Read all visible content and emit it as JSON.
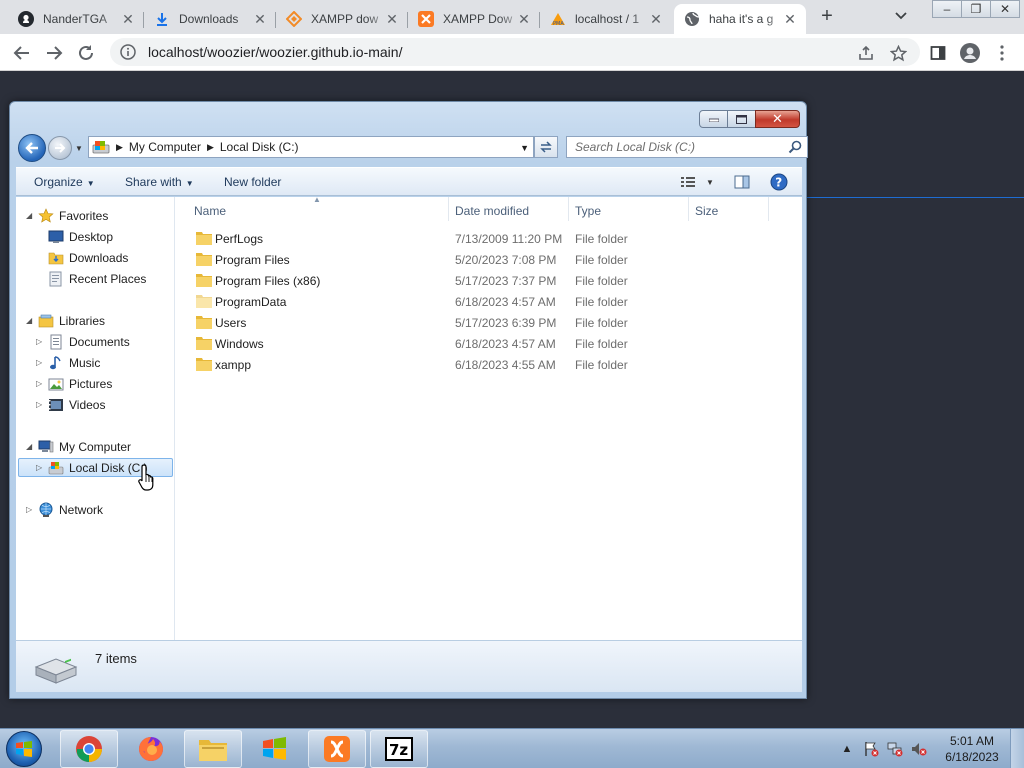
{
  "browser": {
    "tabs": [
      {
        "title": "NanderTGA",
        "icon": "github-icon"
      },
      {
        "title": "Downloads",
        "icon": "download-icon"
      },
      {
        "title": "XAMPP dow",
        "icon": "xampp-diamond-icon"
      },
      {
        "title": "XAMPP Dow",
        "icon": "xampp-icon"
      },
      {
        "title": "localhost / 1",
        "icon": "phpmyadmin-icon"
      },
      {
        "title": "haha it's a g",
        "icon": "globe-icon"
      }
    ],
    "active_tab": 5,
    "url": "localhost/woozier/woozier.github.io-main/"
  },
  "explorer": {
    "breadcrumb": [
      "My Computer",
      "Local Disk (C:)"
    ],
    "search_placeholder": "Search Local Disk (C:)",
    "commands": {
      "organize": "Organize",
      "share_with": "Share with",
      "new_folder": "New folder"
    },
    "nav": {
      "favorites": "Favorites",
      "desktop": "Desktop",
      "downloads": "Downloads",
      "recent_places": "Recent Places",
      "libraries": "Libraries",
      "documents": "Documents",
      "music": "Music",
      "pictures": "Pictures",
      "videos": "Videos",
      "my_computer": "My Computer",
      "local_disk": "Local Disk (C:)",
      "network": "Network"
    },
    "columns": {
      "name": "Name",
      "date_modified": "Date modified",
      "type": "Type",
      "size": "Size"
    },
    "files": [
      {
        "name": "PerfLogs",
        "date": "7/13/2009 11:20 PM",
        "type": "File folder"
      },
      {
        "name": "Program Files",
        "date": "5/20/2023 7:08 PM",
        "type": "File folder"
      },
      {
        "name": "Program Files (x86)",
        "date": "5/17/2023 7:37 PM",
        "type": "File folder"
      },
      {
        "name": "ProgramData",
        "date": "6/18/2023 4:57 AM",
        "type": "File folder"
      },
      {
        "name": "Users",
        "date": "5/17/2023 6:39 PM",
        "type": "File folder"
      },
      {
        "name": "Windows",
        "date": "6/18/2023 4:57 AM",
        "type": "File folder"
      },
      {
        "name": "xampp",
        "date": "6/18/2023 4:55 AM",
        "type": "File folder"
      }
    ],
    "status": "7 items"
  },
  "taskbar": {
    "apps": [
      "chrome-icon",
      "firefox-icon",
      "explorer-icon",
      "windows-update-icon",
      "xampp-icon",
      "7zip-icon"
    ],
    "time": "5:01 AM",
    "date": "6/18/2023"
  },
  "colors": {
    "accent": "#1a73e8",
    "selection": "#cce3fa",
    "folder": "#f4c542"
  }
}
